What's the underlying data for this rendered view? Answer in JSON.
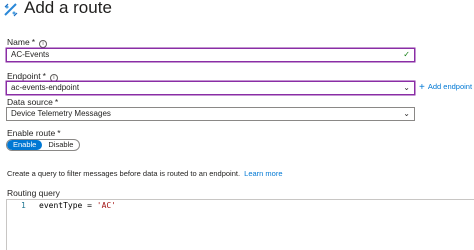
{
  "header": {
    "title": "Add a route"
  },
  "fields": {
    "name": {
      "label": "Name",
      "required": "*",
      "info": "i",
      "value": "AC-Events"
    },
    "endpoint": {
      "label": "Endpoint",
      "required": "*",
      "info": "i",
      "value": "ac-events-endpoint"
    },
    "add_endpoint": {
      "plus": "+",
      "label": "Add endpoint"
    },
    "data_source": {
      "label": "Data source",
      "required": "*",
      "value": "Device Telemetry Messages"
    },
    "enable_route": {
      "label": "Enable route",
      "required": "*",
      "enable_label": "Enable",
      "disable_label": "Disable",
      "selected": "Enable"
    }
  },
  "help": {
    "text": "Create a query to filter messages before data is routed to an endpoint.",
    "link": "Learn more"
  },
  "query": {
    "label": "Routing query",
    "lines": [
      {
        "number": "1",
        "code_key": "eventType = ",
        "code_string": "'AC'"
      }
    ]
  },
  "colors": {
    "accent": "#0078d4",
    "focus_border": "#8a2da5",
    "valid_check": "#107c10"
  }
}
